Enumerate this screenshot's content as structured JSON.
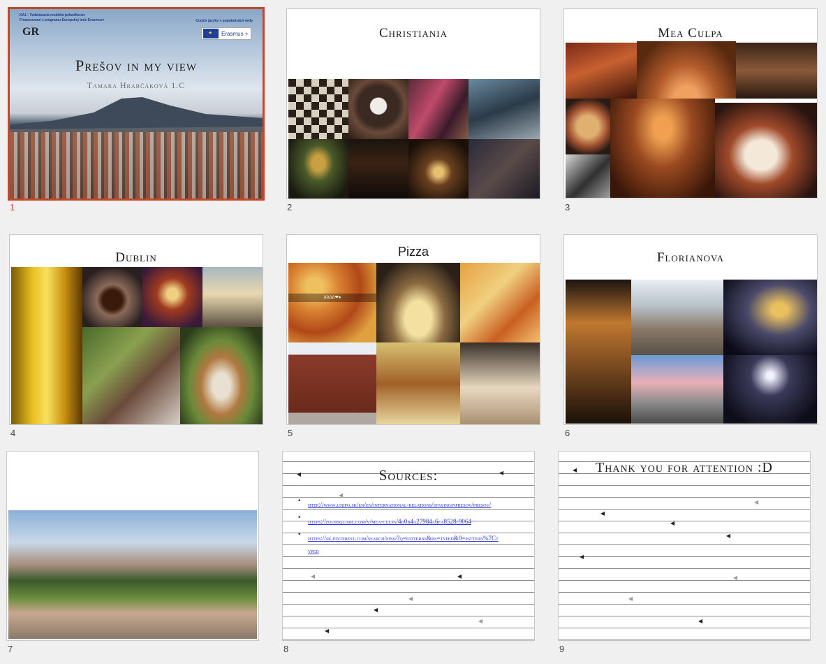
{
  "slides": [
    {
      "number": "1",
      "selected": true,
      "header_left_line1": "KA1 - Vzdelávacia mobilita jednotlivcov",
      "header_left_line2": "Financované z programu Európskej únie Erasmus+",
      "header_right": "Cudzie jazyky v popularizácii vedy",
      "logo_text": "GR",
      "eu_label": "Erasmus +",
      "title": "Prešov in my view",
      "subtitle": "Tamara Hrabčáková 1.C"
    },
    {
      "number": "2",
      "title": "Christiania"
    },
    {
      "number": "3",
      "title": "Mea Culpa"
    },
    {
      "number": "4",
      "title": "Dublin"
    },
    {
      "number": "5",
      "title": "Pizza",
      "pizza_caption": "ΔΔΔΔ❤●"
    },
    {
      "number": "6",
      "title": "Florianova"
    },
    {
      "number": "7"
    },
    {
      "number": "8",
      "title": "Sources:",
      "links": [
        "http://www.unipo.sk/en/en/international-relations/stayinginpresov/presov/",
        "https://foursquare.com/v/mea-culpa/4d0b4a27984a6ea8528f9064",
        "https://sk.pinterest.com/search/pins/?q=patterns&rs=typed&0=pattern%7Ctyped"
      ]
    },
    {
      "number": "9",
      "title": "Thank you for attention :D"
    }
  ]
}
